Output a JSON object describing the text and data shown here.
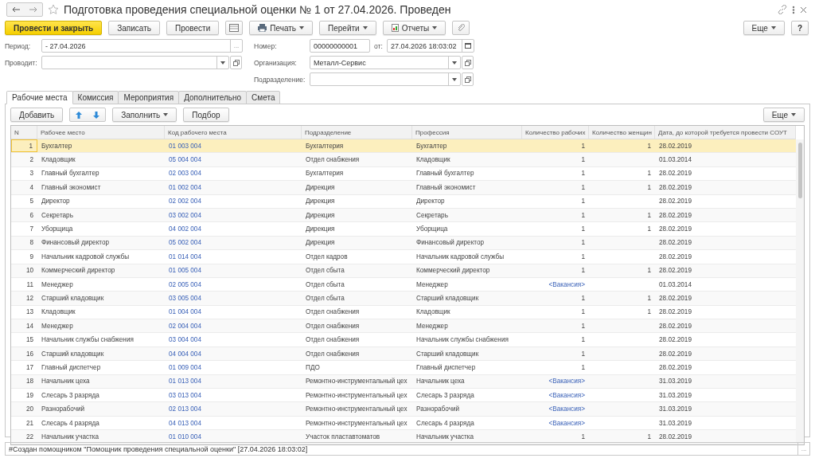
{
  "window": {
    "title": "Подготовка проведения специальной оценки № 1 от 27.04.2026. Проведен",
    "favorite": false
  },
  "toolbar": {
    "buttons": [
      {
        "label": "Провести и закрыть",
        "kind": "primary"
      },
      {
        "label": "Записать",
        "kind": "plain"
      },
      {
        "label": "Провести",
        "kind": "plain"
      },
      {
        "kind": "table"
      },
      {
        "label": "Печать",
        "kind": "print"
      },
      {
        "label": "Перейти",
        "kind": "menu"
      },
      {
        "label": "Отчеты",
        "kind": "report"
      },
      {
        "kind": "clip"
      }
    ],
    "more": "Еще",
    "help": "?"
  },
  "fields": {
    "period": {
      "label": "Период:",
      "value": "- 27.04.2026",
      "button": "..."
    },
    "number": {
      "label": "Номер:",
      "value": "00000000001"
    },
    "date": {
      "label": "от:",
      "value": "27.04.2026 18:03:02"
    },
    "conducts": {
      "label": "Проводит:"
    },
    "organization": {
      "label": "Организация:",
      "value": "Металл-Сервис"
    },
    "division": {
      "label": "Подразделение:"
    }
  },
  "tabs": [
    {
      "label": "Рабочие места",
      "selected": true
    },
    {
      "label": "Комиссия",
      "selected": false
    },
    {
      "label": "Мероприятия",
      "selected": false
    },
    {
      "label": "Дополнительно",
      "selected": false
    },
    {
      "label": "Смета",
      "selected": false
    }
  ],
  "table_toolbar": {
    "add": "Добавить",
    "fill": "Заполнить",
    "pick": "Подбор",
    "more": "Еще"
  },
  "table": {
    "columns": [
      "N",
      "Рабочее место",
      "Код рабочего места",
      "Подразделение",
      "Профессия",
      "Количество рабочих",
      "Количество женщин",
      "Дата, до которой требуется провести СОУТ"
    ],
    "rows": [
      {
        "n": "1",
        "place": "Бухгалтер",
        "code": "01 003 004",
        "division": "Бухгалтерия",
        "profession": "Бухгалтер",
        "workers": "1",
        "vacancy": false,
        "women": "1",
        "date": "28.02.2019",
        "selected": true
      },
      {
        "n": "2",
        "place": "Кладовщик",
        "code": "05 004 004",
        "division": "Отдел снабжения",
        "profession": "Кладовщик",
        "workers": "1",
        "vacancy": false,
        "date": "01.03.2014",
        "selected": false
      },
      {
        "n": "3",
        "place": "Главный бухгалтер",
        "code": "02 003 004",
        "division": "Бухгалтерия",
        "profession": "Главный бухгалтер",
        "workers": "1",
        "vacancy": false,
        "women": "1",
        "date": "28.02.2019",
        "selected": false
      },
      {
        "n": "4",
        "place": "Главный экономист",
        "code": "01 002 004",
        "division": "Дирекция",
        "profession": "Главный экономист",
        "workers": "1",
        "vacancy": false,
        "women": "1",
        "date": "28.02.2019",
        "selected": false
      },
      {
        "n": "5",
        "place": "Директор",
        "code": "02 002 004",
        "division": "Дирекция",
        "profession": "Директор",
        "workers": "1",
        "vacancy": false,
        "date": "28.02.2019",
        "selected": false
      },
      {
        "n": "6",
        "place": "Секретарь",
        "code": "03 002 004",
        "division": "Дирекция",
        "profession": "Секретарь",
        "workers": "1",
        "vacancy": false,
        "women": "1",
        "date": "28.02.2019",
        "selected": false
      },
      {
        "n": "7",
        "place": "Уборщица",
        "code": "04 002 004",
        "division": "Дирекция",
        "profession": "Уборщица",
        "workers": "1",
        "vacancy": false,
        "women": "1",
        "date": "28.02.2019",
        "selected": false
      },
      {
        "n": "8",
        "place": "Финансовый директор",
        "code": "05 002 004",
        "division": "Дирекция",
        "profession": "Финансовый директор",
        "workers": "1",
        "vacancy": false,
        "date": "28.02.2019",
        "selected": false
      },
      {
        "n": "9",
        "place": "Начальник кадровой службы",
        "code": "01 014 004",
        "division": "Отдел кадров",
        "profession": "Начальник кадровой службы",
        "workers": "1",
        "vacancy": false,
        "date": "28.02.2019",
        "selected": false
      },
      {
        "n": "10",
        "place": "Коммерческий директор",
        "code": "01 005 004",
        "division": "Отдел сбыта",
        "profession": "Коммерческий директор",
        "workers": "1",
        "vacancy": false,
        "women": "1",
        "date": "28.02.2019",
        "selected": false
      },
      {
        "n": "11",
        "place": "Менеджер",
        "code": "02 005 004",
        "division": "Отдел сбыта",
        "profession": "Менеджер",
        "workers": "<Вакансия>",
        "vacancy": true,
        "date": "01.03.2014",
        "selected": false
      },
      {
        "n": "12",
        "place": "Старший кладовщик",
        "code": "03 005 004",
        "division": "Отдел сбыта",
        "profession": "Старший кладовщик",
        "workers": "1",
        "vacancy": false,
        "women": "1",
        "date": "28.02.2019",
        "selected": false
      },
      {
        "n": "13",
        "place": "Кладовщик",
        "code": "01 004 004",
        "division": "Отдел снабжения",
        "profession": "Кладовщик",
        "workers": "1",
        "vacancy": false,
        "women": "1",
        "date": "28.02.2019",
        "selected": false
      },
      {
        "n": "14",
        "place": "Менеджер",
        "code": "02 004 004",
        "division": "Отдел снабжения",
        "profession": "Менеджер",
        "workers": "1",
        "vacancy": false,
        "date": "28.02.2019",
        "selected": false
      },
      {
        "n": "15",
        "place": "Начальник службы снабжения",
        "code": "03 004 004",
        "division": "Отдел снабжения",
        "profession": "Начальник службы снабжения",
        "workers": "1",
        "vacancy": false,
        "date": "28.02.2019",
        "selected": false
      },
      {
        "n": "16",
        "place": "Старший кладовщик",
        "code": "04 004 004",
        "division": "Отдел снабжения",
        "profession": "Старший кладовщик",
        "workers": "1",
        "vacancy": false,
        "date": "28.02.2019",
        "selected": false
      },
      {
        "n": "17",
        "place": "Главный диспетчер",
        "code": "01 009 004",
        "division": "ПДО",
        "profession": "Главный диспетчер",
        "workers": "1",
        "vacancy": false,
        "date": "28.02.2019",
        "selected": false
      },
      {
        "n": "18",
        "place": "Начальник цеха",
        "code": "01 013 004",
        "division": "Ремонтно-инструментальный цех",
        "profession": "Начальник цеха",
        "workers": "<Вакансия>",
        "vacancy": true,
        "date": "31.03.2019",
        "selected": false
      },
      {
        "n": "19",
        "place": "Слесарь 3 разряда",
        "code": "03 013 004",
        "division": "Ремонтно-инструментальный цех",
        "profession": "Слесарь 3 разряда",
        "workers": "<Вакансия>",
        "vacancy": true,
        "date": "31.03.2019",
        "selected": false
      },
      {
        "n": "20",
        "place": "Разнорабочий",
        "code": "02 013 004",
        "division": "Ремонтно-инструментальный цех",
        "profession": "Разнорабочий",
        "workers": "<Вакансия>",
        "vacancy": true,
        "date": "31.03.2019",
        "selected": false
      },
      {
        "n": "21",
        "place": "Слесарь 4 разряда",
        "code": "04 013 004",
        "division": "Ремонтно-инструментальный цех",
        "profession": "Слесарь 4 разряда",
        "workers": "<Вакансия>",
        "vacancy": true,
        "date": "31.03.2019",
        "selected": false
      },
      {
        "n": "22",
        "place": "Начальник участка",
        "code": "01 010 004",
        "division": "Участок пластавтоматов",
        "profession": "Начальник участка",
        "workers": "1",
        "vacancy": false,
        "women": "1",
        "date": "28.02.2019",
        "selected": false
      }
    ]
  },
  "comment": {
    "value": "#Создан помощником \"Помощник проведения специальной оценки\" [27.04.2026 18:03:02]",
    "button": "..."
  }
}
